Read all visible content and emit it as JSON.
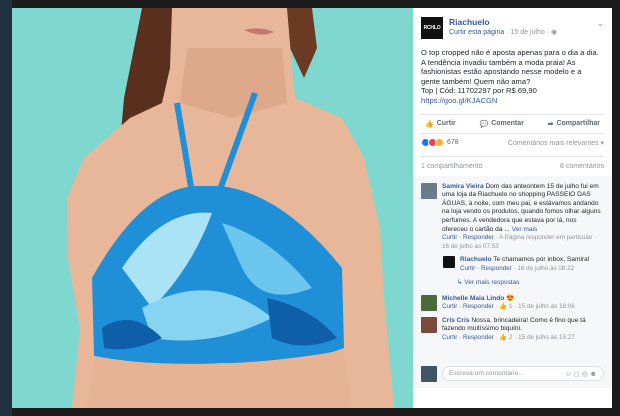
{
  "page": {
    "name": "Riachuelo",
    "logo_text": "RCHLO",
    "like_link": "Curtir esta página",
    "date_line": " · 15 de julho · ",
    "globe": "◉",
    "menu_chevron": "⌄"
  },
  "post": {
    "line1": "O top cropped não é aposta apenas para o dia a dia.",
    "line2": "A tendência invadiu também a moda praia! As",
    "line3": "fashionistas estão apostando nesse modelo e a",
    "line4": "gente também! Quem não ama?",
    "line5": "Top | Cód: 11702297 por R$ 69,90",
    "link": "https://goo.gl/KJACGN"
  },
  "actions": {
    "like": "Curtir",
    "comment": "Comentar",
    "share": "Compartilhar"
  },
  "reactions": {
    "count": "678",
    "sort": "Comentários mais relevantes ▾",
    "colors": [
      "#1877f2",
      "#f33e58",
      "#f7b125"
    ]
  },
  "shares": {
    "count": "1 compartilhamento",
    "comments": "8 comentários"
  },
  "comments": [
    {
      "name": "Samira Vieira",
      "text": " Dom das anteontem 15 de julho fui em uma loja da Riachuelo no shopping PASSEIO DAS ÁGUAS, à noite, com meu pai, e estávamos andando na loja vendo os produtos, quando fomos olhar alguns perfumes. A vendedora que estava por lá, nos ofereceu o cartão da ... ",
      "see_more": "Ver mais",
      "meta_reply": "Curtir · Responder",
      "meta_rest": " · A Página responder em particular · 16 de julho às 07:53",
      "avatar": "#6b7b8a"
    },
    {
      "name": "Riachuelo",
      "text": " Te chamamos por inbox, Samira!",
      "meta_reply": "Curtir · Responder",
      "meta_rest": " · 16 de julho às 08:22",
      "avatar": "#111111",
      "is_reply": true
    },
    {
      "name": "Michelle Maia Lindo",
      "text": " 😍",
      "meta_reply": "Curtir · Responder",
      "meta_rest": " · 👍 1 · 15 de julho às 18:06",
      "avatar": "#4a6b3a"
    },
    {
      "name": "Cris Cris",
      "text": " Nossa, brincadeira! Como é fino que tá fazendo muitíssimo biquíni.",
      "meta_reply": "Curtir · Responder",
      "meta_rest": " · 👍 2 · 15 de julho às 15:27",
      "avatar": "#7a4a3a"
    }
  ],
  "more_replies": "↳ Ver mais respostas",
  "comment_input": {
    "placeholder": "Escreva um comentário...",
    "icons": "☺ ◻ ◎ ☻"
  },
  "icons": {
    "like": "👍",
    "comment": "💬",
    "share": "➦"
  },
  "photo": {
    "background": "#7fd8d0",
    "skin": "#e9b89c",
    "bikini": "#1f8fd8"
  }
}
